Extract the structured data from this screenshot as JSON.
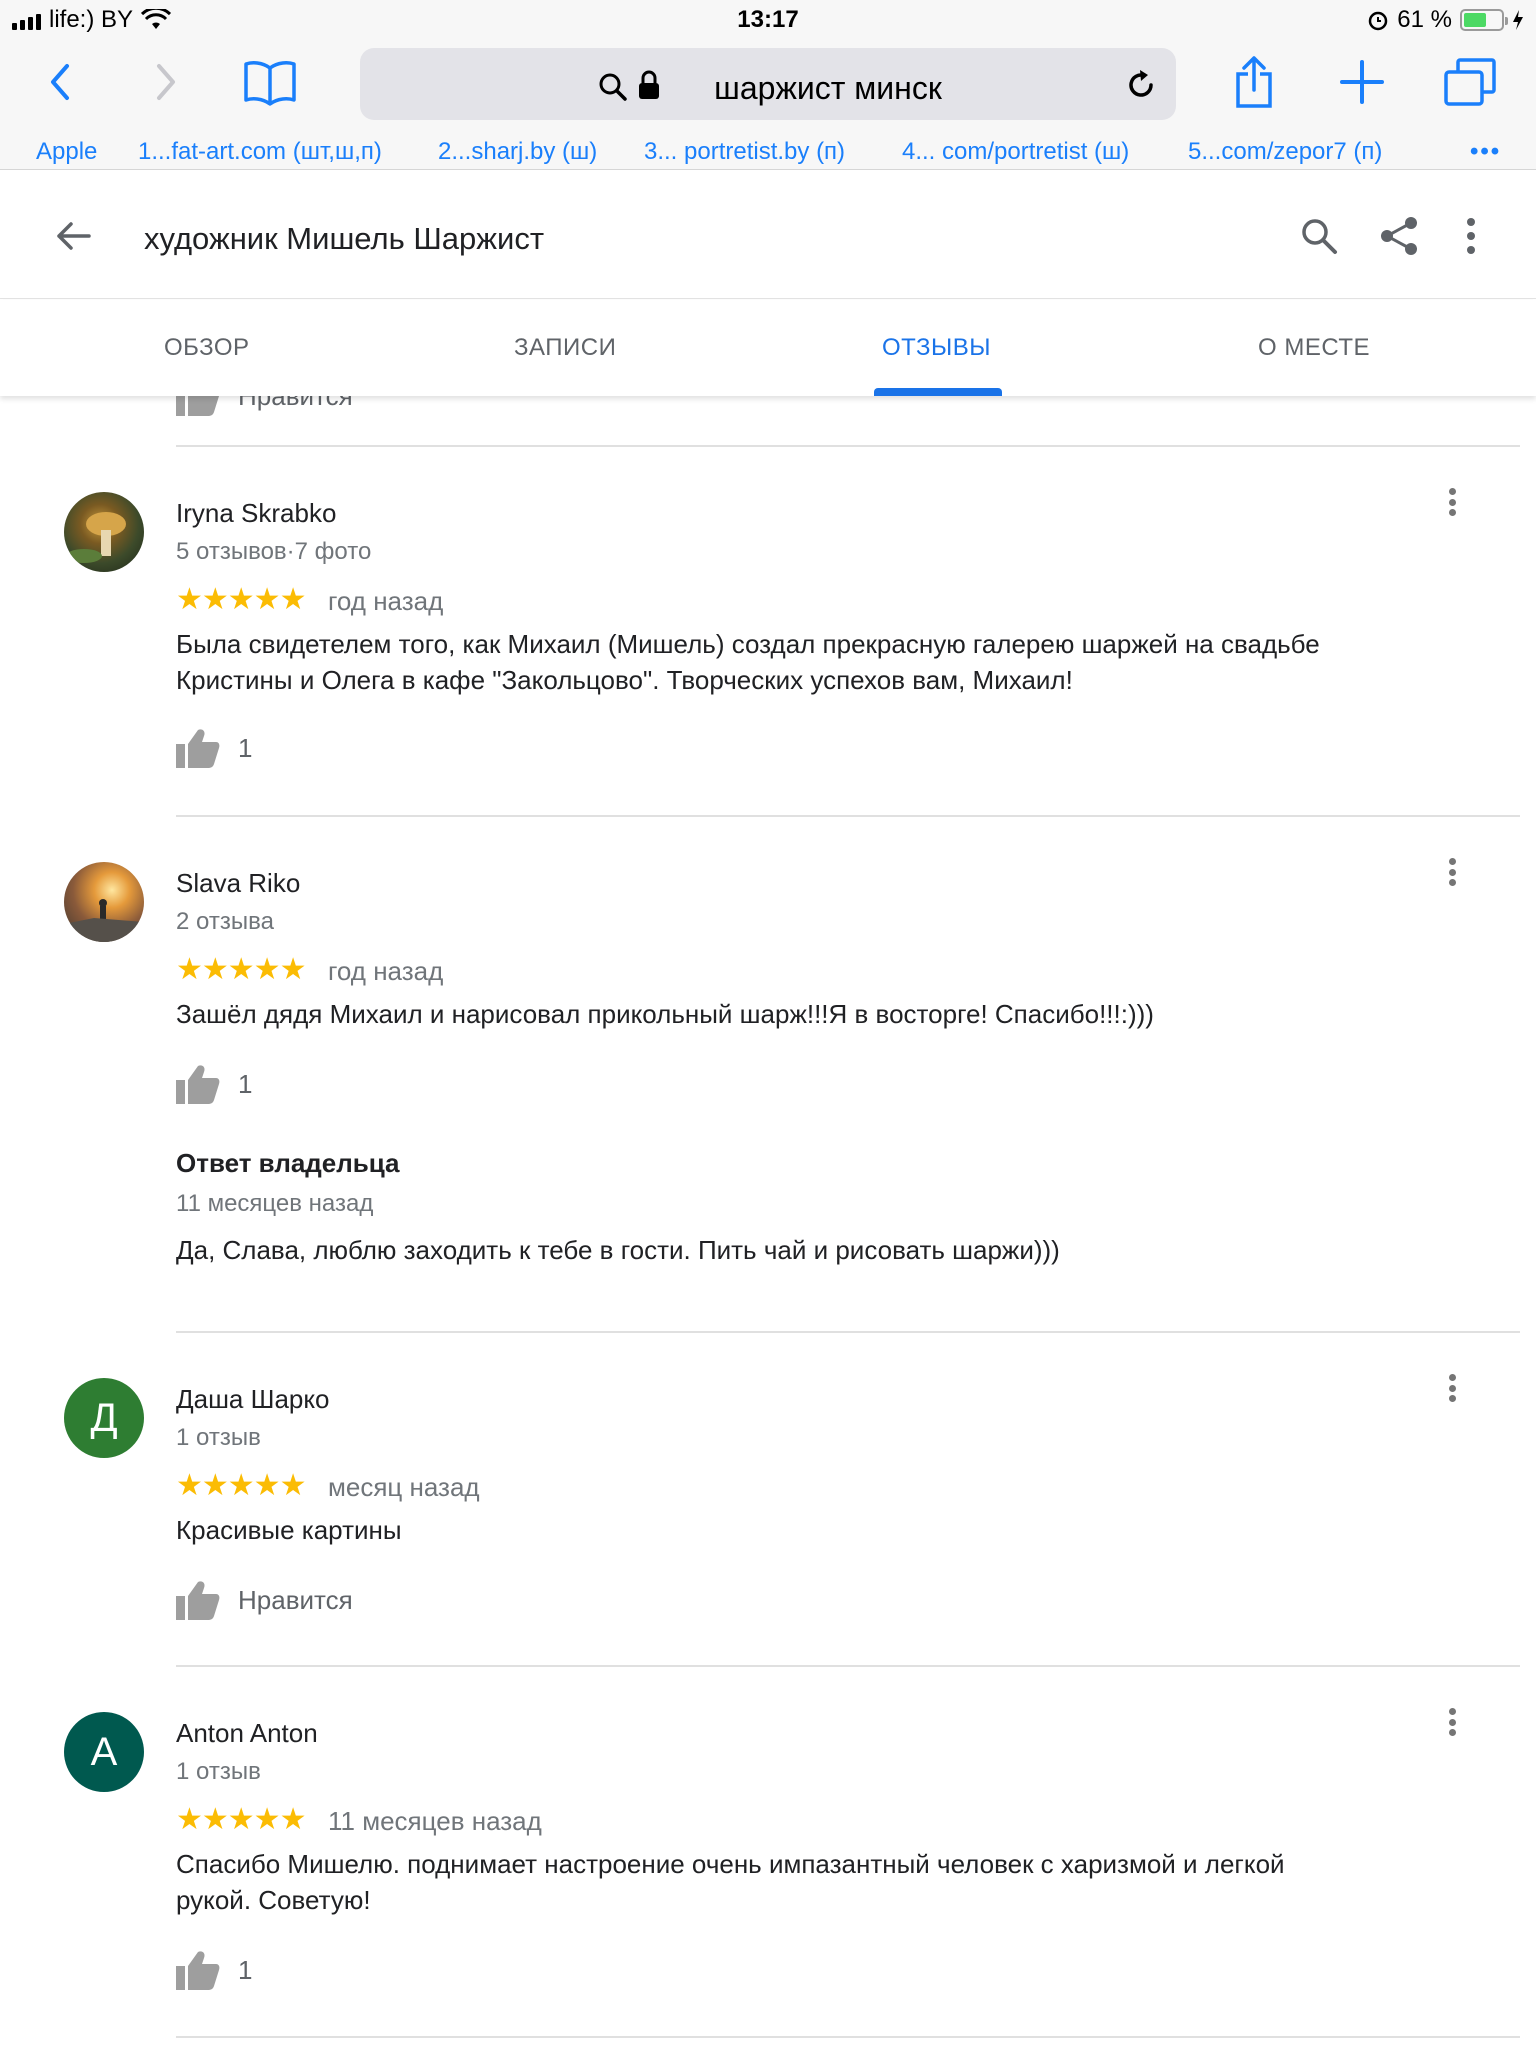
{
  "status_bar": {
    "carrier": "life:) BY",
    "time": "13:17",
    "battery_percent": "61 %",
    "battery_level": 0.61
  },
  "browser": {
    "url_text": "шаржист минск",
    "favorites": [
      "Apple",
      "1...fat-art.com (шт,ш,п)",
      "2...sharj.by (ш)",
      "3... portretist.by (п)",
      "4... com/portretist (ш)",
      "5...com/zepor7 (п)"
    ],
    "more": "•••"
  },
  "app_header": {
    "title": "художник Мишель Шаржист"
  },
  "tabs": [
    {
      "label": "ОБЗОР",
      "active": false
    },
    {
      "label": "ЗАПИСИ",
      "active": false
    },
    {
      "label": "ОТЗЫВЫ",
      "active": true
    },
    {
      "label": "О МЕСТЕ",
      "active": false
    }
  ],
  "partial_like_label": "Нравится",
  "reviews": [
    {
      "author": "Iryna Skrabko",
      "meta": "5 отзывов·7 фото",
      "stars": "★★★★★",
      "rating": 5,
      "time": "год назад",
      "text": "Была свидетелем того, как Михаил (Мишель) создал прекрасную галерею шаржей на свадьбе Кристины и Олега в кафе \"Закольцово\". Творческих успехов вам, Михаил!",
      "likes": "1"
    },
    {
      "author": "Slava Riko",
      "meta": "2 отзыва",
      "stars": "★★★★★",
      "rating": 5,
      "time": "год назад",
      "text": "Зашёл дядя Михаил и нарисовал прикольный шарж!!!Я в восторге! Спасибо!!!:)))",
      "likes": "1",
      "owner_reply": {
        "heading": "Ответ владельца",
        "time": "11 месяцев назад",
        "text": "Да, Слава, люблю заходить к тебе в гости. Пить чай и рисовать шаржи)))"
      }
    },
    {
      "author": "Даша Шарко",
      "initial": "Д",
      "avatar_color": "#2e7d32",
      "meta": "1 отзыв",
      "stars": "★★★★★",
      "rating": 5,
      "time": "месяц назад",
      "text": "Красивые картины",
      "likes": "Нравится"
    },
    {
      "author": "Anton Anton",
      "initial": "A",
      "avatar_color": "#00594f",
      "meta": "1 отзыв",
      "stars": "★★★★★",
      "rating": 5,
      "time": "11 месяцев назад",
      "text": "Спасибо Мишелю. поднимает настроение очень импазантный человек с харизмой и легкой рукой. Советую!",
      "likes": "1"
    }
  ],
  "colors": {
    "accent": "#1a73e8",
    "star": "#fbbc04",
    "link": "#1a7ffb"
  },
  "icons": [
    "back-chevron-icon",
    "forward-chevron-icon",
    "bookmarks-icon",
    "search-icon",
    "lock-icon",
    "reload-icon",
    "share-icon",
    "new-tab-icon",
    "tabs-icon",
    "arrow-back-icon",
    "share-nodes-icon",
    "more-vert-icon",
    "thumb-up-icon"
  ]
}
